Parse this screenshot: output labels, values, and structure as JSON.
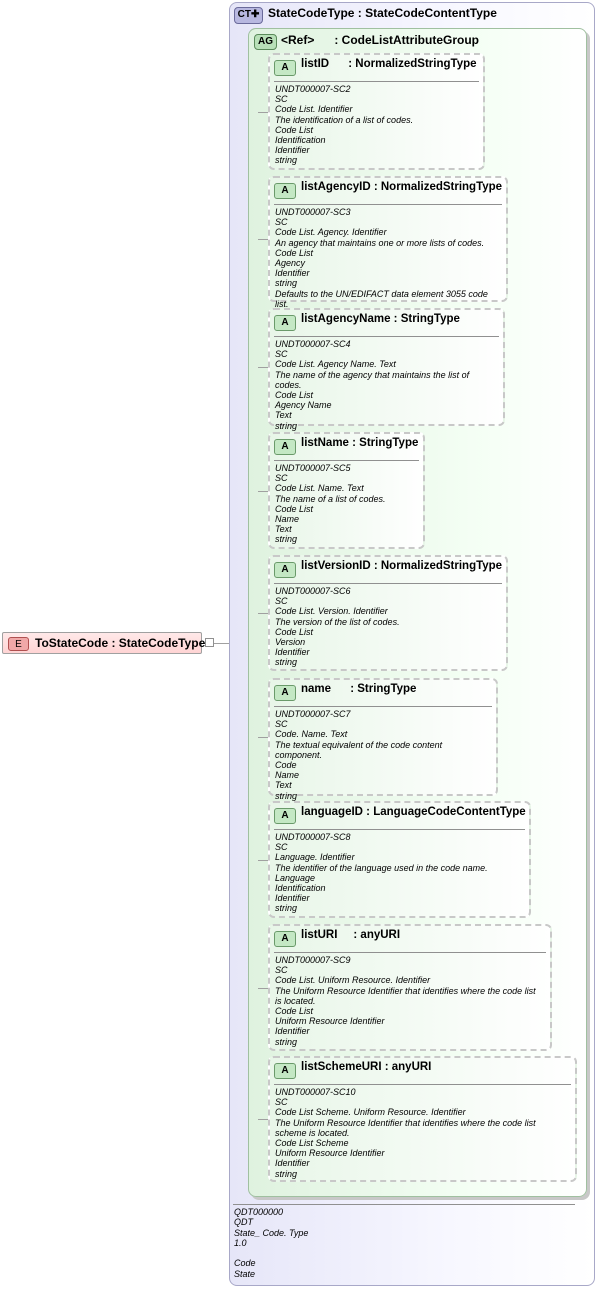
{
  "element": {
    "badge": "E",
    "label": "ToStateCode : StateCodeType"
  },
  "complex_type": {
    "badge": "CT",
    "badge_symbol": "✚",
    "title": "StateCodeType : StateCodeContentType",
    "footer": [
      "QDT000000",
      "QDT",
      "State_ Code. Type",
      "1.0",
      "",
      "Code",
      "State"
    ]
  },
  "attribute_group": {
    "badge": "AG",
    "title": "<Ref>      : CodeListAttributeGroup"
  },
  "attributes": [
    {
      "badge": "A",
      "title": "listID      : NormalizedStringType",
      "lines": [
        "UNDT000007-SC2",
        "SC",
        "Code List. Identifier",
        "The identification of a list of codes.",
        "Code List",
        "Identification",
        "Identifier",
        "string"
      ]
    },
    {
      "badge": "A",
      "title": "listAgencyID : NormalizedStringType",
      "lines": [
        "UNDT000007-SC3",
        "SC",
        "Code List. Agency. Identifier",
        "An agency that maintains one or more lists of codes.",
        "Code List",
        "Agency",
        "Identifier",
        "string",
        "Defaults to the UN/EDIFACT data element 3055 code list."
      ]
    },
    {
      "badge": "A",
      "title": "listAgencyName : StringType",
      "lines": [
        "UNDT000007-SC4",
        "SC",
        "Code List. Agency Name. Text",
        "The name of the agency that maintains the list of codes.",
        "Code List",
        "Agency Name",
        "Text",
        "string"
      ]
    },
    {
      "badge": "A",
      "title": "listName : StringType",
      "lines": [
        "UNDT000007-SC5",
        "SC",
        "Code List. Name. Text",
        "The name of a list of codes.",
        "Code List",
        "Name",
        "Text",
        "string"
      ]
    },
    {
      "badge": "A",
      "title": "listVersionID : NormalizedStringType",
      "lines": [
        "UNDT000007-SC6",
        "SC",
        "Code List. Version. Identifier",
        "The version of the list of codes.",
        "Code List",
        "Version",
        "Identifier",
        "string"
      ]
    },
    {
      "badge": "A",
      "title": "name      : StringType",
      "lines": [
        "UNDT000007-SC7",
        "SC",
        "Code. Name. Text",
        "The textual equivalent of the code content component.",
        "Code",
        "Name",
        "Text",
        "string"
      ]
    },
    {
      "badge": "A",
      "title": "languageID : LanguageCodeContentType",
      "lines": [
        "UNDT000007-SC8",
        "SC",
        "Language. Identifier",
        "The identifier of the language used in the code name.",
        "Language",
        "Identification",
        "Identifier",
        "string"
      ]
    },
    {
      "badge": "A",
      "title": "listURI     : anyURI",
      "lines": [
        "UNDT000007-SC9",
        "SC",
        "Code List. Uniform Resource. Identifier",
        "The Uniform Resource Identifier that identifies where the code list is located.",
        "Code List",
        "Uniform Resource Identifier",
        "Identifier",
        "string"
      ]
    },
    {
      "badge": "A",
      "title": "listSchemeURI : anyURI",
      "lines": [
        "UNDT000007-SC10",
        "SC",
        "Code List Scheme. Uniform Resource. Identifier",
        "The Uniform Resource Identifier that identifies where the code list scheme is located.",
        "Code List Scheme",
        "Uniform Resource Identifier",
        "Identifier",
        "string"
      ]
    }
  ]
}
